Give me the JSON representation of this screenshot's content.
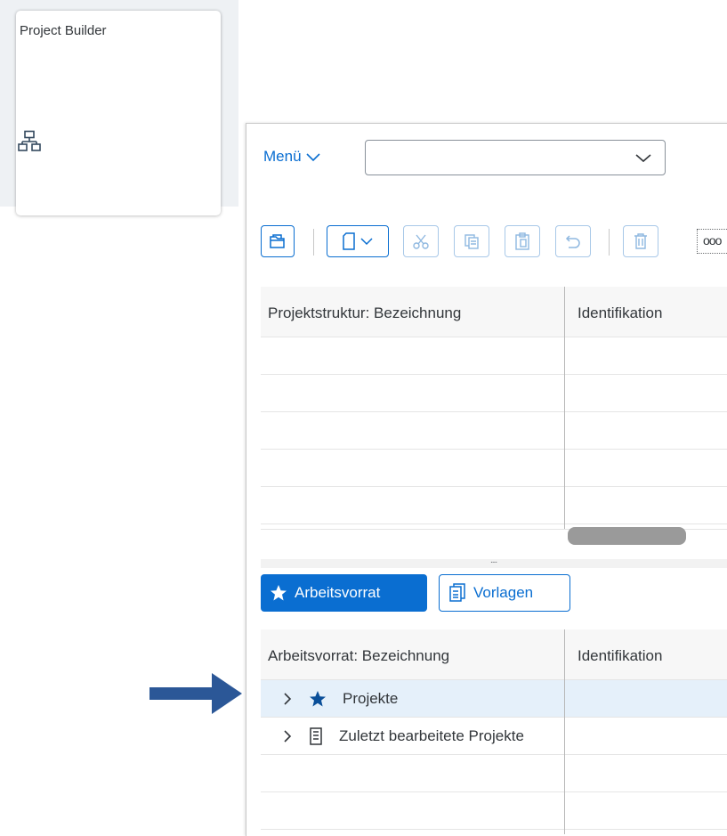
{
  "tile": {
    "title": "Project Builder",
    "icon": "hierarchy-icon"
  },
  "header": {
    "menu_label": "Menü",
    "menu_select_value": ""
  },
  "toolbar": {
    "buttons": [
      "open-icon",
      "create-icon",
      "cut-icon",
      "copy-icon",
      "paste-icon",
      "undo-icon",
      "delete-icon",
      "more-icon"
    ],
    "more_label": "ooo"
  },
  "structure_table": {
    "columns": [
      "Projektstruktur: Bezeichnung",
      "Identifikation"
    ],
    "rows": [
      [
        "",
        ""
      ],
      [
        "",
        ""
      ],
      [
        "",
        ""
      ],
      [
        "",
        ""
      ],
      [
        "",
        ""
      ]
    ]
  },
  "splitter_label": "....",
  "tabs": [
    {
      "label": "Arbeitsvorrat",
      "icon": "star-icon",
      "active": true
    },
    {
      "label": "Vorlagen",
      "icon": "template-icon",
      "active": false
    }
  ],
  "worklist_table": {
    "columns": [
      "Arbeitsvorrat: Bezeichnung",
      "Identifikation"
    ],
    "rows": [
      {
        "label": "Projekte",
        "icon": "star-icon",
        "identification": "",
        "selected": true
      },
      {
        "label": "Zuletzt bearbeitete Projekte",
        "icon": "document-icon",
        "identification": "",
        "selected": false
      }
    ]
  },
  "colors": {
    "accent": "#0a6ed1",
    "selected_row": "#e5f0fa",
    "arrow": "#2b5797"
  }
}
